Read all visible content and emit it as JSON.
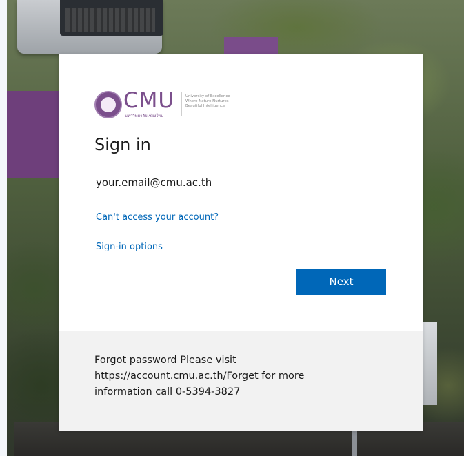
{
  "logo": {
    "text": "CMU",
    "subtitle": "มหาวิทยาลัยเชียงใหม่",
    "tagline": "University of Excellence Where Nature Nurtures Beautiful Intelligence"
  },
  "title": "Sign in",
  "email": {
    "value": "your.email@cmu.ac.th",
    "placeholder": "your.email@cmu.ac.th"
  },
  "links": {
    "cant_access": "Can't access your account?",
    "signin_options": "Sign-in options"
  },
  "next_label": "Next",
  "footer": {
    "line1": "Forgot password Please visit",
    "line2": "https://account.cmu.ac.th/Forget for more",
    "line3": "information call 0-5394-3827"
  },
  "colors": {
    "primary": "#0067b8",
    "brand_purple": "#7b4f8c",
    "footer_bg": "#f2f2f2"
  }
}
